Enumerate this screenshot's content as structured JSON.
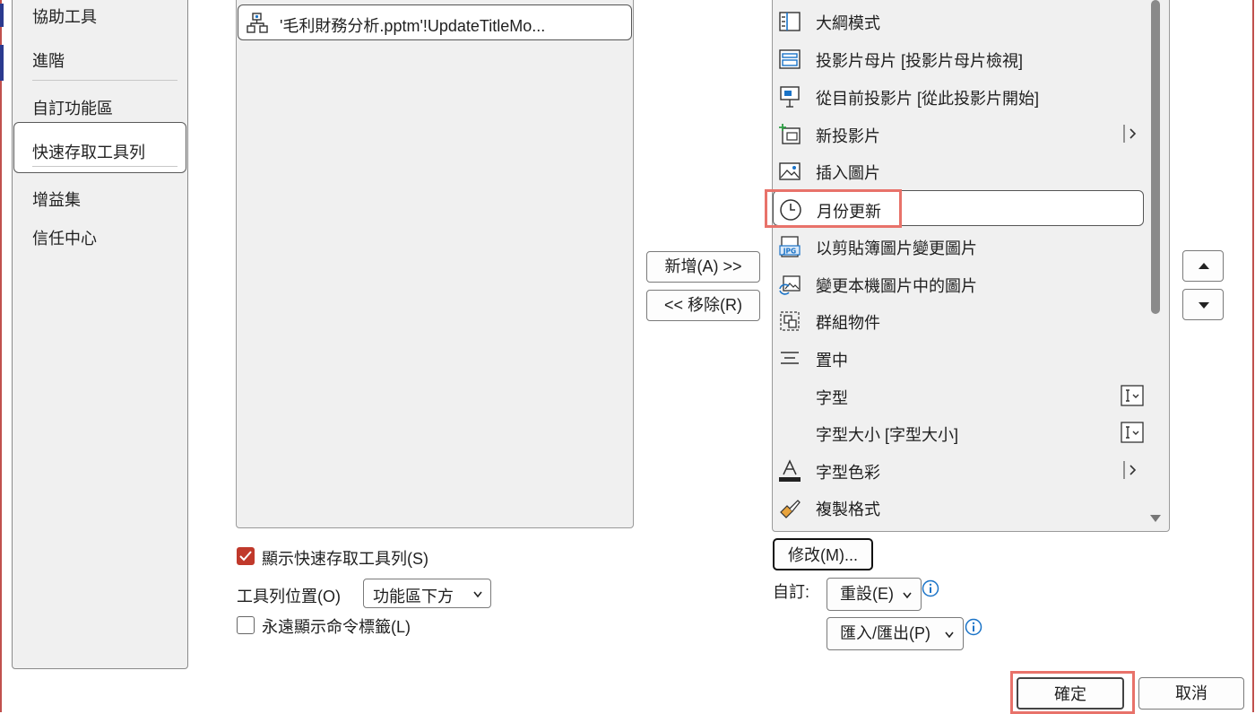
{
  "nav": {
    "items": [
      "協助工具",
      "進階",
      "自訂功能區",
      "快速存取工具列",
      "增益集",
      "信任中心"
    ],
    "selected": "快速存取工具列"
  },
  "left_list": {
    "items": [
      {
        "label": "'毛利財務分析.pptm'!UpdateTitleMo...",
        "icon": "macro-icon"
      }
    ]
  },
  "middle": {
    "add_label": "新增(A) >>",
    "remove_label": "<< 移除(R)"
  },
  "right_list": {
    "items": [
      {
        "label": "大綱模式",
        "icon": "outline-view-icon"
      },
      {
        "label": "投影片母片 [投影片母片檢視]",
        "icon": "slide-master-icon"
      },
      {
        "label": "從目前投影片 [從此投影片開始]",
        "icon": "present-from-current-icon"
      },
      {
        "label": "新投影片",
        "icon": "new-slide-icon",
        "suffix": "submenu-arrow-icon"
      },
      {
        "label": "插入圖片",
        "icon": "insert-picture-icon"
      },
      {
        "label": "月份更新",
        "icon": "clock-icon",
        "selected": true
      },
      {
        "label": "以剪貼簿圖片變更圖片",
        "icon": "jpg-picture-icon"
      },
      {
        "label": "變更本機圖片中的圖片",
        "icon": "change-picture-icon"
      },
      {
        "label": "群組物件",
        "icon": "group-objects-icon"
      },
      {
        "label": "置中",
        "icon": "align-center-icon"
      },
      {
        "label": "字型",
        "icon": "",
        "suffix": "text-box-dropdown-icon"
      },
      {
        "label": "字型大小 [字型大小]",
        "icon": "",
        "suffix": "text-box-dropdown-icon"
      },
      {
        "label": "字型色彩",
        "icon": "font-color-icon",
        "suffix": "submenu-arrow-icon"
      },
      {
        "label": "複製格式",
        "icon": "format-painter-icon"
      }
    ]
  },
  "modify_label": "修改(M)...",
  "custom_label": "自訂:",
  "reset_label": "重設(E)",
  "import_export_label": "匯入/匯出(P)",
  "show_qat": {
    "label": "顯示快速存取工具列(S)",
    "checked": true
  },
  "toolbar_position": {
    "label": "工具列位置(O)",
    "value": "功能區下方"
  },
  "always_show_labels": {
    "label": "永遠顯示命令標籤(L)",
    "checked": false
  },
  "ok_label": "確定",
  "cancel_label": "取消",
  "colors": {
    "accent_check": "#c0392b",
    "highlight": "#e8726a",
    "info_blue": "#1a73c7"
  }
}
